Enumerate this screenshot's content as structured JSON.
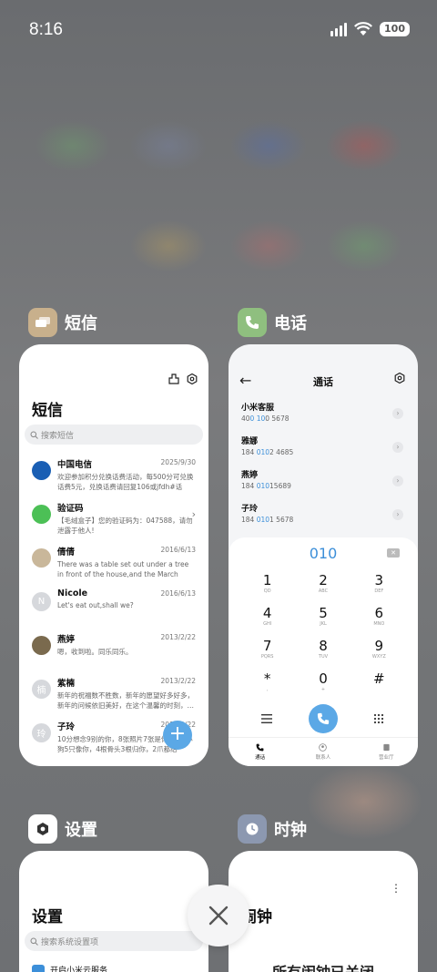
{
  "status_bar": {
    "time": "8:16",
    "battery": "100"
  },
  "apps": {
    "sms": {
      "name": "短信",
      "title": "短信",
      "search_placeholder": "搜索短信",
      "messages": [
        {
          "name": "中国电信",
          "date": "2025/9/30",
          "body": "欢迎参加积分兑换话费活动，每500分可兑换话费5元，兑换话费请回复106或jfdh#话费…",
          "avatar": "",
          "avatar_color": "#1a5fb4"
        },
        {
          "name": "验证码",
          "date": "",
          "body": "【毛绒盒子】您的验证码为：047588，请勿泄露于他人!",
          "avatar": "",
          "avatar_color": "#4cc056"
        },
        {
          "name": "倩倩",
          "date": "2016/6/13",
          "body": "There was a table set out under a tree in front of the house,and the March Hare an…",
          "avatar": "",
          "avatar_color": "#c9b79a"
        },
        {
          "name": "Nicole",
          "date": "2016/6/13",
          "body": "Let's eat out,shall we?",
          "avatar": "N",
          "avatar_color": "#d6d8dc"
        },
        {
          "name": "燕婷",
          "date": "2013/2/22",
          "body": "嗯，收到啦。同乐同乐。",
          "avatar": "",
          "avatar_color": "#7a6a4e"
        },
        {
          "name": "紫楠",
          "date": "2013/2/22",
          "body": "新年的祝福数不胜数，新年的愿望好多好多，新年的问候依旧美好，在这个温馨的时刻，…",
          "avatar": "楠",
          "avatar_color": "#d6d8dc"
        },
        {
          "name": "子玲",
          "date": "2013/2/22",
          "body": "10分想念9别的你，8张照片7张是你，6只小狗5只像你，4根骨头3根归你，2爪都给你，…",
          "avatar": "玲",
          "avatar_color": "#d6d8dc"
        }
      ],
      "fab": "+"
    },
    "phone": {
      "name": "电话",
      "title": "通话",
      "contacts": [
        {
          "name": "小米客服",
          "num_pre": "40",
          "num_hl": "0 10",
          "num_post": "0 5678"
        },
        {
          "name": "雅娜",
          "num_pre": "184 ",
          "num_hl": "010",
          "num_post": "2 4685"
        },
        {
          "name": "燕婷",
          "num_pre": "184 ",
          "num_hl": "010",
          "num_post": "15689"
        },
        {
          "name": "子玲",
          "num_pre": "184 ",
          "num_hl": "010",
          "num_post": "1 5678"
        }
      ],
      "dialed": "010",
      "keys": [
        {
          "d": "1",
          "l": "QD"
        },
        {
          "d": "2",
          "l": "ABC"
        },
        {
          "d": "3",
          "l": "DEF"
        },
        {
          "d": "4",
          "l": "GHI"
        },
        {
          "d": "5",
          "l": "JKL"
        },
        {
          "d": "6",
          "l": "MNO"
        },
        {
          "d": "7",
          "l": "PQRS"
        },
        {
          "d": "8",
          "l": "TUV"
        },
        {
          "d": "9",
          "l": "WXYZ"
        },
        {
          "d": "*",
          "l": ","
        },
        {
          "d": "0",
          "l": "+"
        },
        {
          "d": "#",
          "l": ""
        }
      ],
      "tabs": [
        "通话",
        "联系人",
        "营业厅"
      ]
    },
    "settings": {
      "name": "设置",
      "title": "设置",
      "search_placeholder": "搜索系统设置项",
      "first_item": "开启小米云服务"
    },
    "clock": {
      "name": "时钟",
      "title": "闹钟",
      "message": "所有闹钟已关闭"
    }
  },
  "colors": {
    "accent": "#5ba8e6",
    "sms_icon": "#c8b08c",
    "phone_icon": "#8fbf7f",
    "clock_icon": "#8c98b0"
  }
}
